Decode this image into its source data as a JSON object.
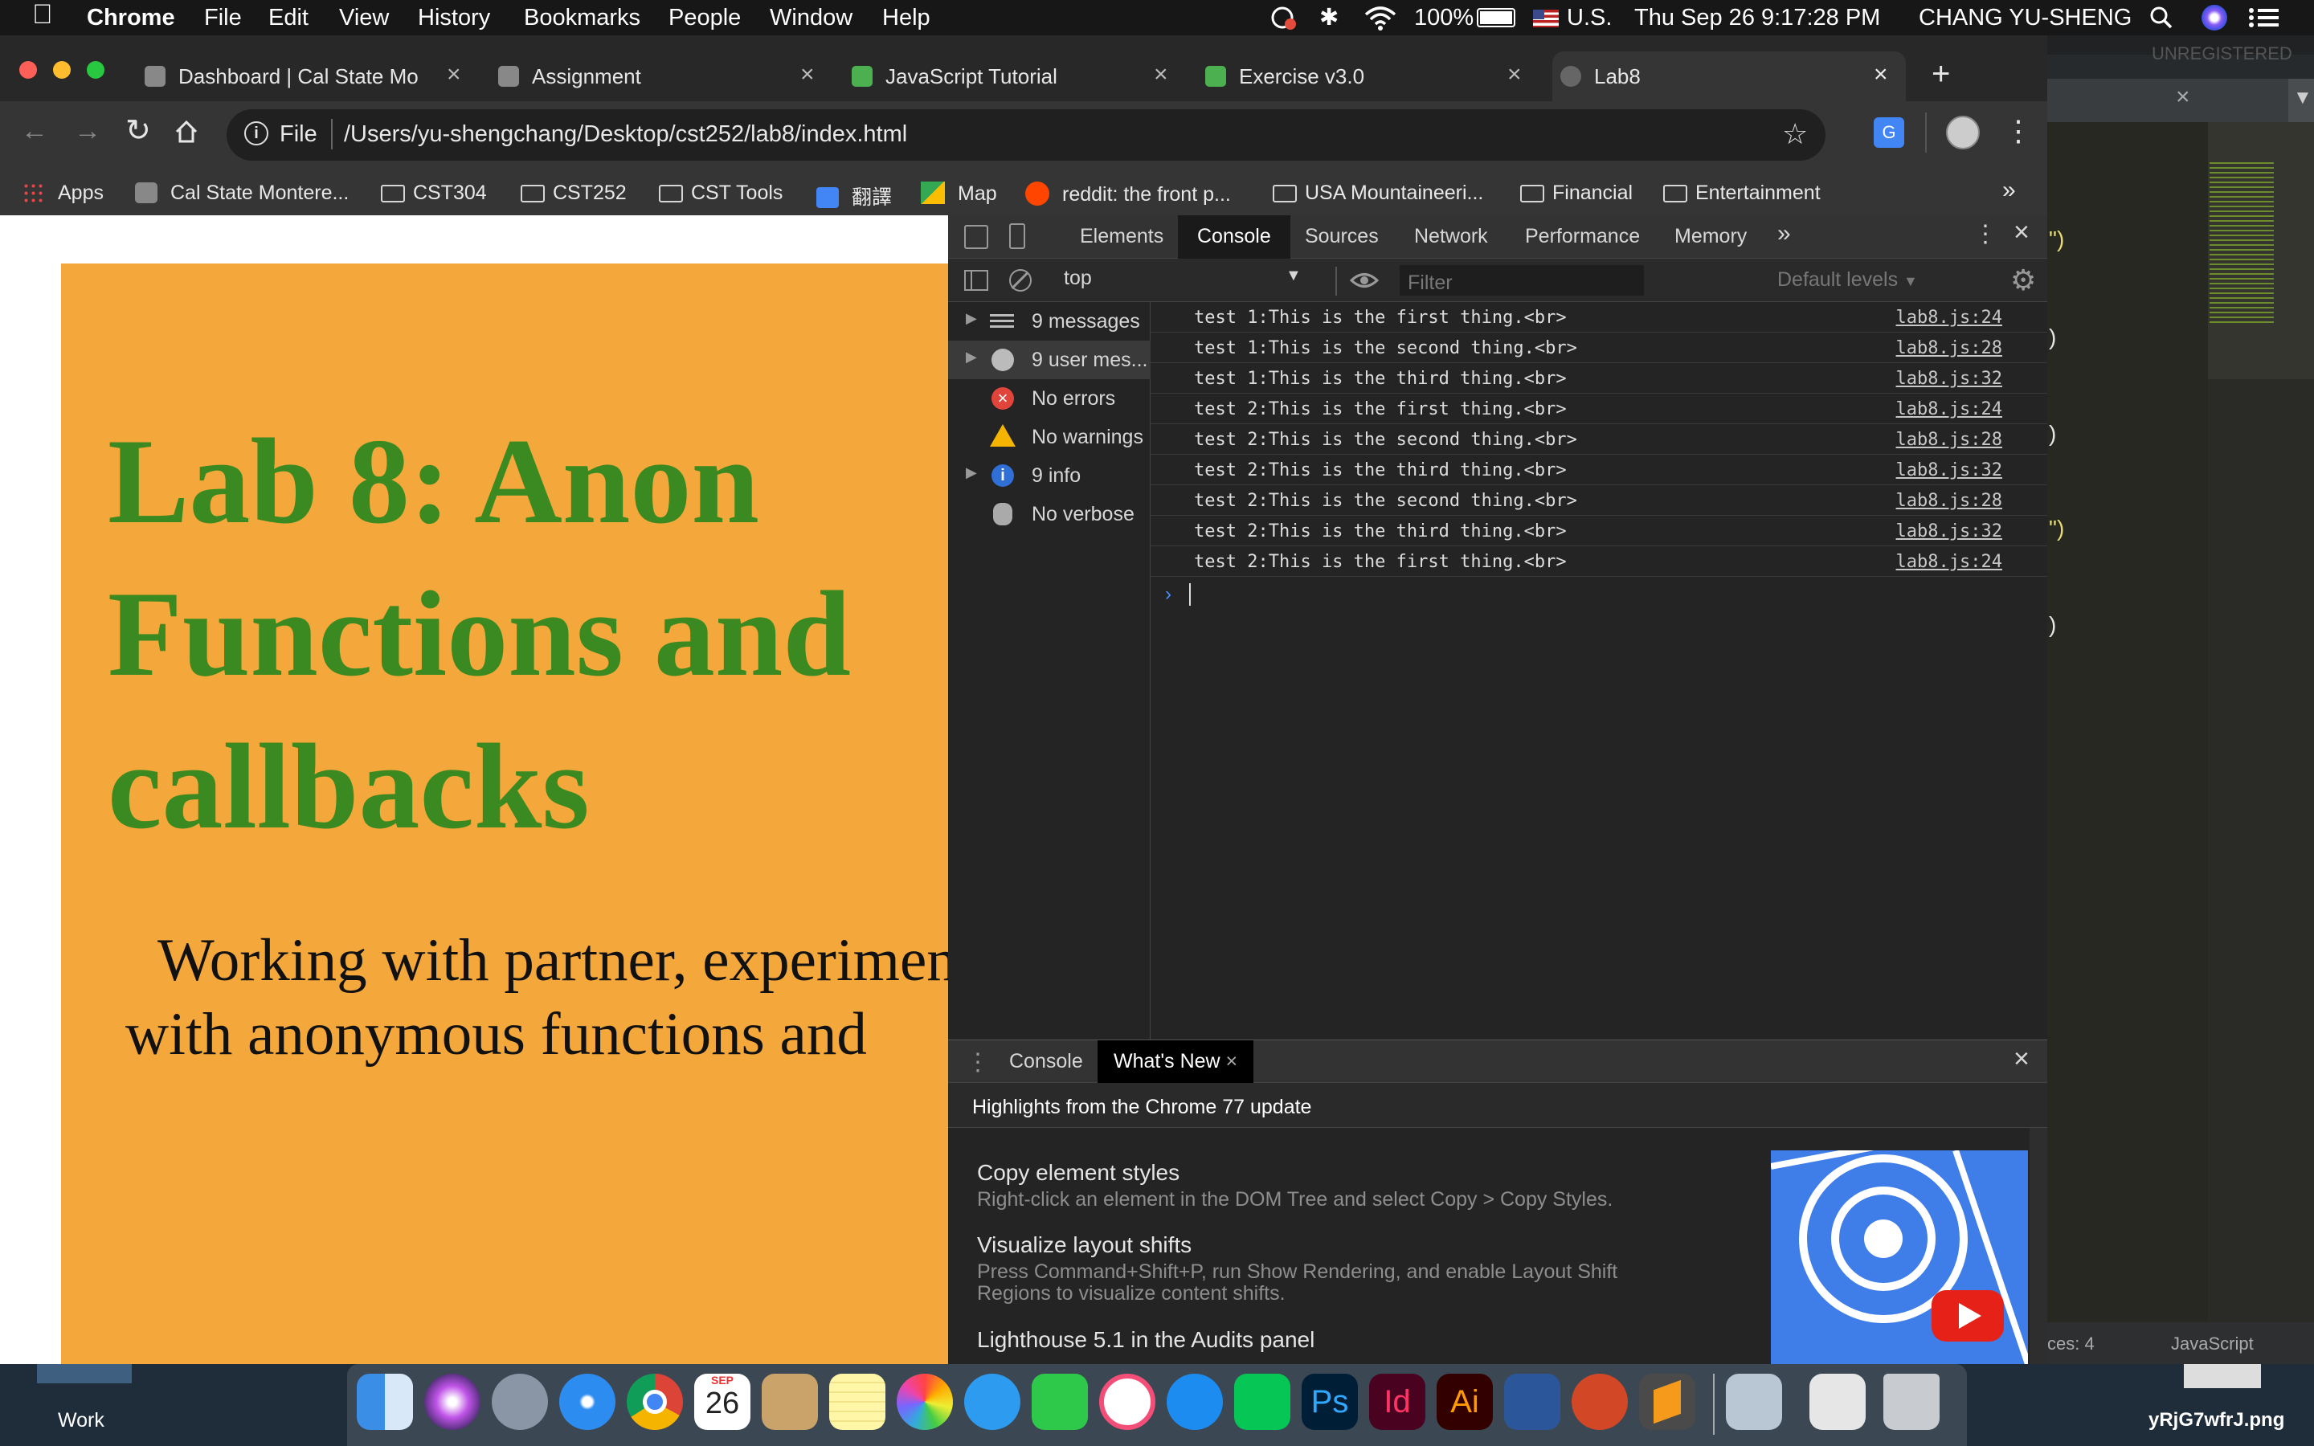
{
  "menubar": {
    "app": "Chrome",
    "menus": [
      "File",
      "Edit",
      "View",
      "History",
      "Bookmarks",
      "People",
      "Window",
      "Help"
    ],
    "battery": "100%",
    "input_source": "U.S.",
    "datetime": "Thu Sep 26  9:17:28 PM",
    "user": "CHANG YU-SHENG"
  },
  "tabs": [
    {
      "title": "Dashboard | Cal State Monte",
      "icon": "cal-state-icon",
      "active": false
    },
    {
      "title": "Assignment",
      "icon": "cal-state-icon",
      "active": false
    },
    {
      "title": "JavaScript Tutorial",
      "icon": "w3schools-icon",
      "active": false
    },
    {
      "title": "Exercise v3.0",
      "icon": "w3schools-icon",
      "active": false
    },
    {
      "title": "Lab8",
      "icon": "globe-icon",
      "active": true
    }
  ],
  "omnibox": {
    "scheme": "File",
    "url": "/Users/yu-shengchang/Desktop/cst252/lab8/index.html"
  },
  "bookmarks": [
    {
      "label": "Apps",
      "icon": "apps-grid-icon"
    },
    {
      "label": "Cal State Montere...",
      "icon": "cal-state-icon"
    },
    {
      "label": "CST304",
      "icon": "folder-icon"
    },
    {
      "label": "CST252",
      "icon": "folder-icon"
    },
    {
      "label": "CST Tools",
      "icon": "folder-icon"
    },
    {
      "label": "翻譯",
      "icon": "google-translate-icon"
    },
    {
      "label": "Map",
      "icon": "maps-icon"
    },
    {
      "label": "reddit: the front p...",
      "icon": "reddit-icon"
    },
    {
      "label": "USA Mountaineeri...",
      "icon": "folder-icon"
    },
    {
      "label": "Financial",
      "icon": "folder-icon"
    },
    {
      "label": "Entertainment",
      "icon": "folder-icon"
    }
  ],
  "page": {
    "heading": "Lab 8: Anon Functions and callbacks",
    "paragraph": "Working with partner, experiment with anonymous functions and callbacks",
    "colors": {
      "background": "#f4a73a",
      "heading": "#3a8a21"
    }
  },
  "devtools": {
    "tabs": [
      "Elements",
      "Console",
      "Sources",
      "Network",
      "Performance",
      "Memory"
    ],
    "active_tab": "Console",
    "context": "top",
    "filter_placeholder": "Filter",
    "levels": "Default levels",
    "sidebar": [
      {
        "label": "9 messages",
        "icon": "list-icon",
        "expandable": true
      },
      {
        "label": "9 user mes...",
        "icon": "user-icon",
        "expandable": true
      },
      {
        "label": "No errors",
        "icon": "error-icon",
        "expandable": false
      },
      {
        "label": "No warnings",
        "icon": "warning-icon",
        "expandable": false
      },
      {
        "label": "9 info",
        "icon": "info-icon",
        "expandable": true
      },
      {
        "label": "No verbose",
        "icon": "bug-icon",
        "expandable": false
      }
    ],
    "logs": [
      {
        "msg": "test 1:This is the first thing.<br>",
        "src": "lab8.js:24"
      },
      {
        "msg": "test 1:This is the second thing.<br>",
        "src": "lab8.js:28"
      },
      {
        "msg": "test 1:This is the third thing.<br>",
        "src": "lab8.js:32"
      },
      {
        "msg": "test 2:This is the first thing.<br>",
        "src": "lab8.js:24"
      },
      {
        "msg": "test 2:This is the second thing.<br>",
        "src": "lab8.js:28"
      },
      {
        "msg": "test 2:This is the third thing.<br>",
        "src": "lab8.js:32"
      },
      {
        "msg": "test 2:This is the second thing.<br>",
        "src": "lab8.js:28"
      },
      {
        "msg": "test 2:This is the third thing.<br>",
        "src": "lab8.js:32"
      },
      {
        "msg": "test 2:This is the first thing.<br>",
        "src": "lab8.js:24"
      }
    ],
    "drawer": {
      "tabs": [
        "Console",
        "What's New"
      ],
      "active_tab": "What's New",
      "highlight": "Highlights from the Chrome 77 update",
      "features": [
        {
          "title": "Copy element styles",
          "desc": "Right-click an element in the DOM Tree and select Copy > Copy Styles."
        },
        {
          "title": "Visualize layout shifts",
          "desc": "Press Command+Shift+P, run Show Rendering, and enable Layout Shift Regions to visualize content shifts."
        },
        {
          "title": "Lighthouse 5.1 in the Audits panel",
          "desc": ""
        }
      ]
    }
  },
  "editor": {
    "unregistered": "UNREGISTERED",
    "status_left": "ces: 4",
    "status_right": "JavaScript",
    "snippets": [
      "\")",
      ")",
      ")",
      "\")",
      ")"
    ]
  },
  "desktop": {
    "label": "Work",
    "filename": "yRjG7wfrJ.png"
  },
  "dock": [
    "Finder",
    "Siri",
    "Launchpad",
    "Safari",
    "Chrome",
    "Calendar",
    "Preview",
    "Notes",
    "Photos",
    "Messages",
    "FaceTime",
    "iTunes",
    "App Store",
    "LINE",
    "Photoshop",
    "InDesign",
    "Illustrator",
    "Word",
    "PowerPoint",
    "Sublime Text",
    "Image Capture",
    "Documents",
    "Trash"
  ],
  "dock_calendar": {
    "month": "SEP",
    "day": "26"
  }
}
